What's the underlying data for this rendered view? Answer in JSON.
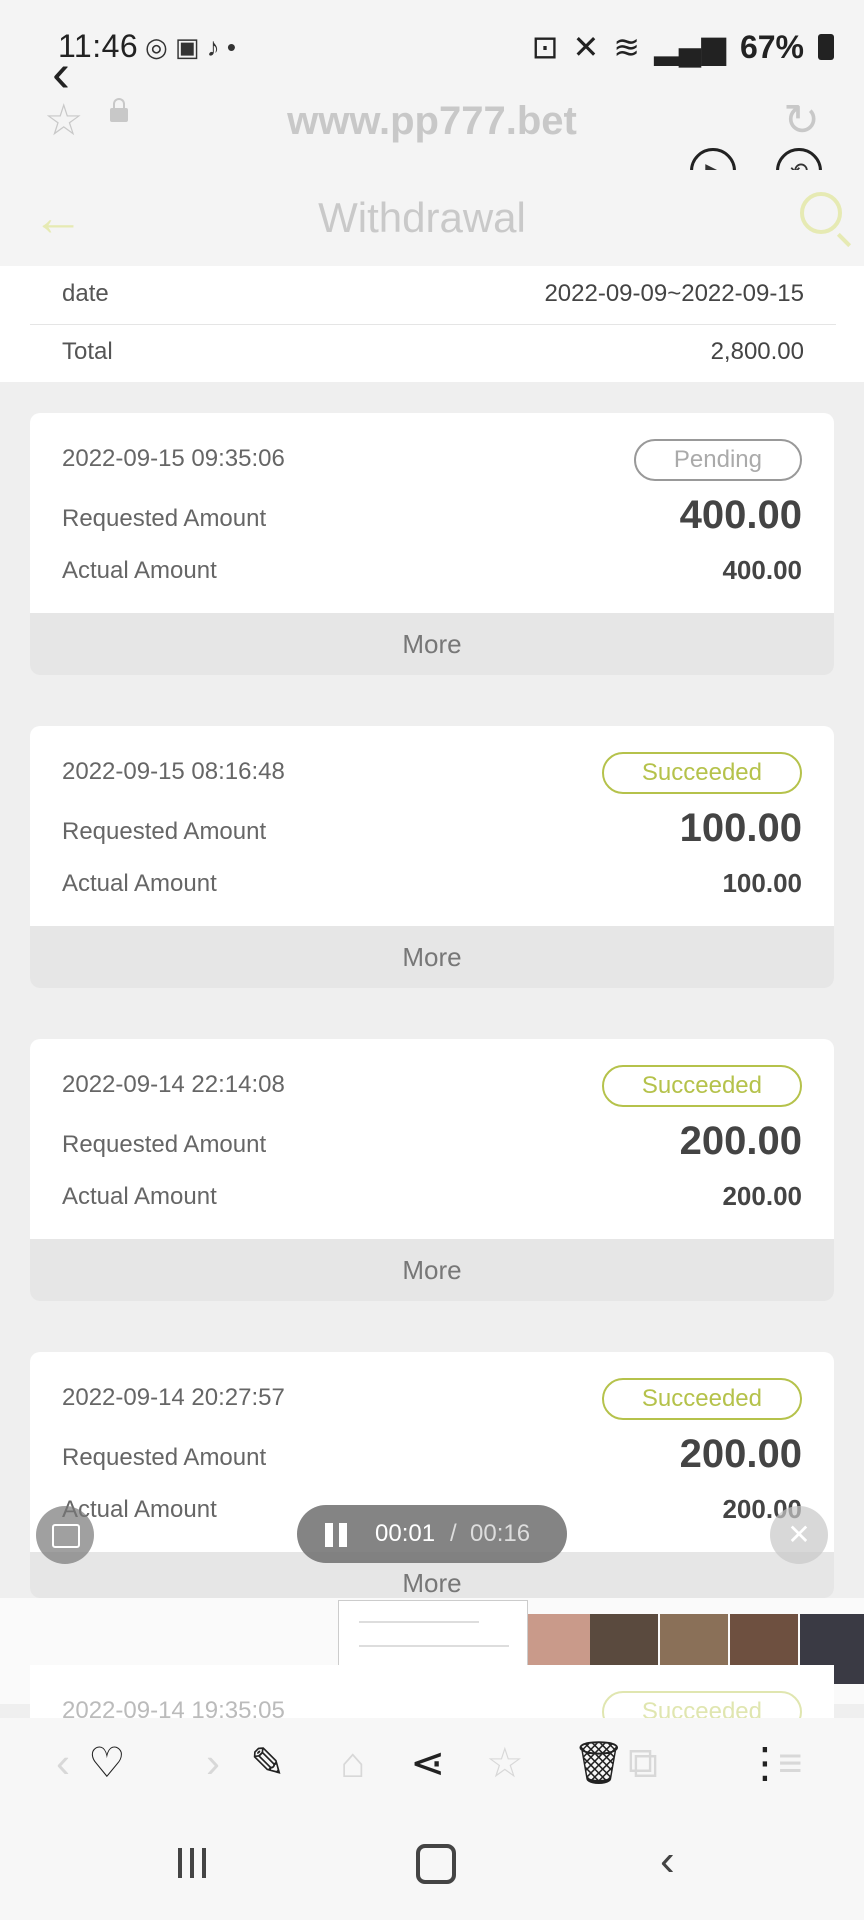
{
  "status_bar": {
    "time": "11:46",
    "battery": "67%",
    "icons": [
      "chrome-icon",
      "gallery-icon",
      "tiktok-icon",
      "dot-icon",
      "battery-saver-icon",
      "mute-icon",
      "wifi-icon",
      "signal-icon",
      "signal-icon",
      "battery-icon"
    ]
  },
  "browser": {
    "url": "www.pp777.bet"
  },
  "page": {
    "title": "Withdrawal"
  },
  "summary": {
    "date_label": "date",
    "date_value": "2022-09-09~2022-09-15",
    "total_label": "Total",
    "total_value": "2,800.00"
  },
  "labels": {
    "requested": "Requested Amount",
    "actual": "Actual Amount",
    "more": "More"
  },
  "records": [
    {
      "timestamp": "2022-09-15 09:35:06",
      "status": "Pending",
      "requested": "400.00",
      "actual": "400.00"
    },
    {
      "timestamp": "2022-09-15 08:16:48",
      "status": "Succeeded",
      "requested": "100.00",
      "actual": "100.00"
    },
    {
      "timestamp": "2022-09-14 22:14:08",
      "status": "Succeeded",
      "requested": "200.00",
      "actual": "200.00"
    },
    {
      "timestamp": "2022-09-14 20:27:57",
      "status": "Succeeded",
      "requested": "200.00",
      "actual": "200.00"
    },
    {
      "timestamp": "2022-09-14 19:35:05",
      "status": "Succeeded"
    }
  ],
  "video": {
    "current": "00:01",
    "separator": "/",
    "total": "00:16"
  },
  "toolbar": {
    "icons": [
      "heart-icon",
      "pencil-icon",
      "share-icon",
      "trash-icon",
      "more-vert-icon"
    ]
  },
  "colors": {
    "accent": "#b5c24b",
    "pending": "#999999",
    "background": "#efefef"
  }
}
